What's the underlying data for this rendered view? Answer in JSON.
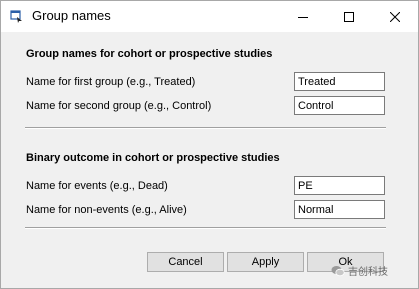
{
  "window": {
    "title": "Group names",
    "icons": {
      "app": "app-window-icon",
      "minimize": "minimize-icon",
      "maximize": "maximize-icon",
      "close": "close-icon"
    }
  },
  "cohort_section": {
    "heading": "Group names for cohort or prospective studies",
    "first_group_label": "Name for first group (e.g., Treated)",
    "first_group_value": "Treated",
    "second_group_label": "Name for second group (e.g., Control)",
    "second_group_value": "Control"
  },
  "outcome_section": {
    "heading": "Binary outcome in cohort or prospective studies",
    "events_label": "Name for events (e.g., Dead)",
    "events_value": "PE",
    "non_events_label": "Name for non-events (e.g., Alive)",
    "non_events_value": "Normal"
  },
  "buttons": {
    "cancel": "Cancel",
    "apply": "Apply",
    "ok": "Ok"
  },
  "watermark": {
    "text": "吉创科技",
    "icon": "wechat-icon"
  }
}
